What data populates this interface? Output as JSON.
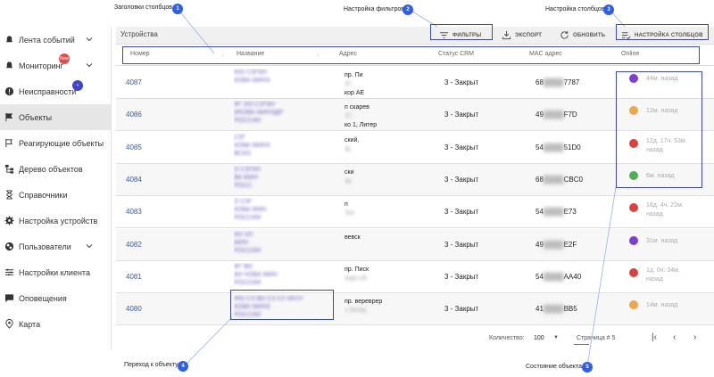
{
  "sidebar": {
    "items": [
      {
        "label": "Лента событий",
        "icon": "bell-icon",
        "has_chevron": true
      },
      {
        "label": "Мониторинг",
        "icon": "bell-icon",
        "has_chevron": true,
        "badge": "New"
      },
      {
        "label": "Неисправности",
        "icon": "alert-circle-icon",
        "badge": "+"
      },
      {
        "label": "Объекты",
        "icon": "flag-icon",
        "active": true
      },
      {
        "label": "Реагирующие объекты",
        "icon": "flag-outline-icon"
      },
      {
        "label": "Дерево объектов",
        "icon": "tree-icon"
      },
      {
        "label": "Справочники",
        "icon": "hourglass-icon"
      },
      {
        "label": "Настройка устройств",
        "icon": "gear-icon"
      },
      {
        "label": "Пользователи",
        "icon": "globe-icon",
        "has_chevron": true
      },
      {
        "label": "Настройки клиента",
        "icon": "sliders-icon"
      },
      {
        "label": "Оповещения",
        "icon": "message-icon"
      },
      {
        "label": "Карта",
        "icon": "map-pin-icon"
      }
    ]
  },
  "toolbar": {
    "title": "Устройства",
    "filters_label": "ФИЛЬТРЫ",
    "export_label": "ЭКСПОРТ",
    "refresh_label": "ОБНОВИТЬ",
    "columns_label": "НАСТРОЙКА СТОЛБЦОВ"
  },
  "table": {
    "columns": [
      "Номер",
      "Название",
      "Адрес",
      "Статус CRM",
      "MAC адрес",
      "Online"
    ],
    "rows": [
      {
        "num": "4087",
        "name": [
          "ЮО СЗГМУ",
          "КОВА МИНЗ"
        ],
        "addr": [
          "пр. Пи",
          "47,",
          "кор АЕ"
        ],
        "status": "3 - Закрыт",
        "mac": [
          "68",
          "7787"
        ],
        "dot": "#7b3fd6",
        "online": [
          "44м. назад"
        ]
      },
      {
        "num": "4086",
        "name": [
          "ФГ ИО СЗГМУ",
          "ИКОВА МИНЗДР",
          "РОССИИ"
        ],
        "addr": [
          "п скарев",
          "47,",
          "ко 1, Литер"
        ],
        "status": "3 - Закрыт",
        "mac": [
          "49",
          "F7D"
        ],
        "dot": "#f2a54a",
        "online": [
          "12м. назад"
        ]
      },
      {
        "num": "4085",
        "name": [
          "СЗГ",
          "КОВА МИНЗ",
          "ВСКО"
        ],
        "addr": [
          "ский,",
          "Щ"
        ],
        "status": "3 - Закрыт",
        "mac": [
          "54",
          "51D0"
        ],
        "dot": "#d9433f",
        "online": [
          "12д. 17ч. 53м.",
          "назад"
        ]
      },
      {
        "num": "4084",
        "name": [
          "О СЗГМУ",
          "ВА МИН",
          "РОСС"
        ],
        "addr": [
          "ски",
          "ер"
        ],
        "status": "3 - Закрыт",
        "mac": [
          "68",
          "CBC0"
        ],
        "dot": "#4caf50",
        "online": [
          "6м. назад"
        ]
      },
      {
        "num": "4083",
        "name": [
          "О СЗГ",
          "КОВА МИН",
          "РОССИИ"
        ],
        "addr": [
          "п",
          "Лит"
        ],
        "status": "3 - Закрыт",
        "mac": [
          "54",
          "E73"
        ],
        "dot": "#d9433f",
        "online": [
          "16д. 4ч. 22м.",
          "назад"
        ]
      },
      {
        "num": "4082",
        "name": [
          "МУ ИУ",
          "МИН",
          "РОССИИ"
        ],
        "addr": [
          "вевск"
        ],
        "status": "3 - Закрыт",
        "mac": [
          "49",
          "E2F"
        ],
        "dot": "#7b3fd6",
        "online": [
          "31м. назад"
        ]
      },
      {
        "num": "4081",
        "name": [
          "ФГ ВО",
          "МУ КОВА МИН",
          "РОССИИ"
        ],
        "addr": [
          "пр. Писк",
          "корп.18,"
        ],
        "status": "3 - Закрыт",
        "mac": [
          "54",
          "AA40"
        ],
        "dot": "#d9433f",
        "online": [
          "1д. 0ч. 34м.",
          "назад"
        ]
      },
      {
        "num": "4080",
        "name": [
          "ФЮ СЗ ВО СЗ СУ ИКУУ",
          "КОВА МИНЗ",
          "РОССИИ"
        ],
        "addr": [
          "пр. вереврер",
          "к Литер"
        ],
        "status": "3 - Закрыт",
        "mac": [
          "41",
          "BB5"
        ],
        "dot": "#f2a54a",
        "online": [
          "14м. назад"
        ]
      }
    ]
  },
  "footer": {
    "count_label": "Количество:",
    "count_value": "100",
    "page_label": "Страница # 5"
  },
  "annotations": [
    {
      "n": "1",
      "label": "Заголовки столбцов"
    },
    {
      "n": "2",
      "label": "Настройка фильтров"
    },
    {
      "n": "3",
      "label": "Настройка столбцов"
    },
    {
      "n": "4",
      "label": "Переход к объекту"
    },
    {
      "n": "5",
      "label": "Состояние объекта"
    }
  ]
}
